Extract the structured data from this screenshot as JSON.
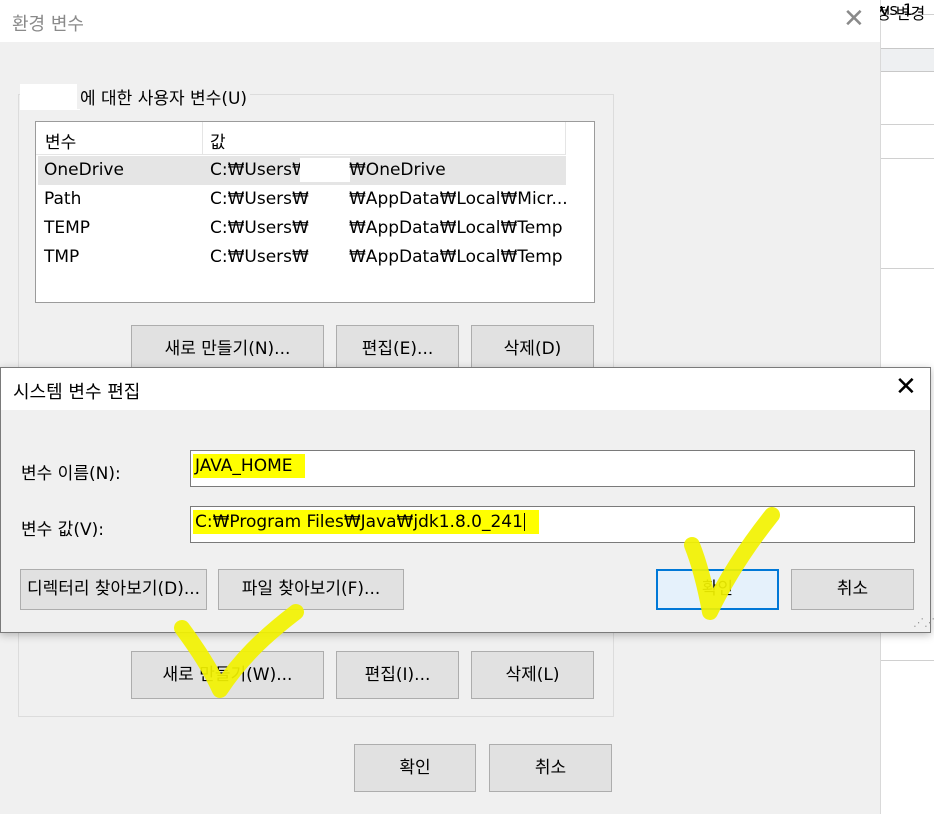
{
  "env_dialog": {
    "title": "환경 변수",
    "user_group_label": "에 대한 사용자 변수(U)",
    "list": {
      "columns": [
        "변수",
        "값"
      ],
      "rows": [
        {
          "name": "OneDrive",
          "value_prefix": "C:₩Users₩",
          "value_suffix": "₩OneDrive"
        },
        {
          "name": "Path",
          "value_prefix": "C:₩Users₩",
          "value_suffix": "₩AppData₩Local₩Micr..."
        },
        {
          "name": "TEMP",
          "value_prefix": "C:₩Users₩",
          "value_suffix": "₩AppData₩Local₩Temp"
        },
        {
          "name": "TMP",
          "value_prefix": "C:₩Users₩",
          "value_suffix": "₩AppData₩Local₩Temp"
        }
      ]
    },
    "user_buttons": {
      "new": "새로 만들기(N)...",
      "edit": "편집(E)...",
      "delete": "삭제(D)"
    },
    "system_buttons": {
      "new": "새로 만들기(W)...",
      "edit": "편집(I)...",
      "delete": "삭제(L)"
    },
    "ok": "확인",
    "cancel": "취소"
  },
  "edit_dialog": {
    "title": "시스템 변수 편집",
    "name_label": "변수 이름(N):",
    "name_value": "JAVA_HOME",
    "value_label": "변수 값(V):",
    "value_value": "C:₩Program Files₩Java₩jdk1.8.0_241",
    "browse_dir": "디렉터리 찾아보기(D)...",
    "browse_file": "파일 찾아보기(F)...",
    "ok": "확인",
    "cancel": "취소",
    "highlight_color": "#ffff00"
  },
  "background_window": {
    "logo_text": "vs 1",
    "link_text": "정 변경"
  },
  "icons": {
    "close": "close-icon",
    "resize": "resize-grip-icon",
    "annotation": "checkmark-annotation"
  },
  "colors": {
    "annotation": "#f2f200",
    "accent": "#0078d7"
  }
}
